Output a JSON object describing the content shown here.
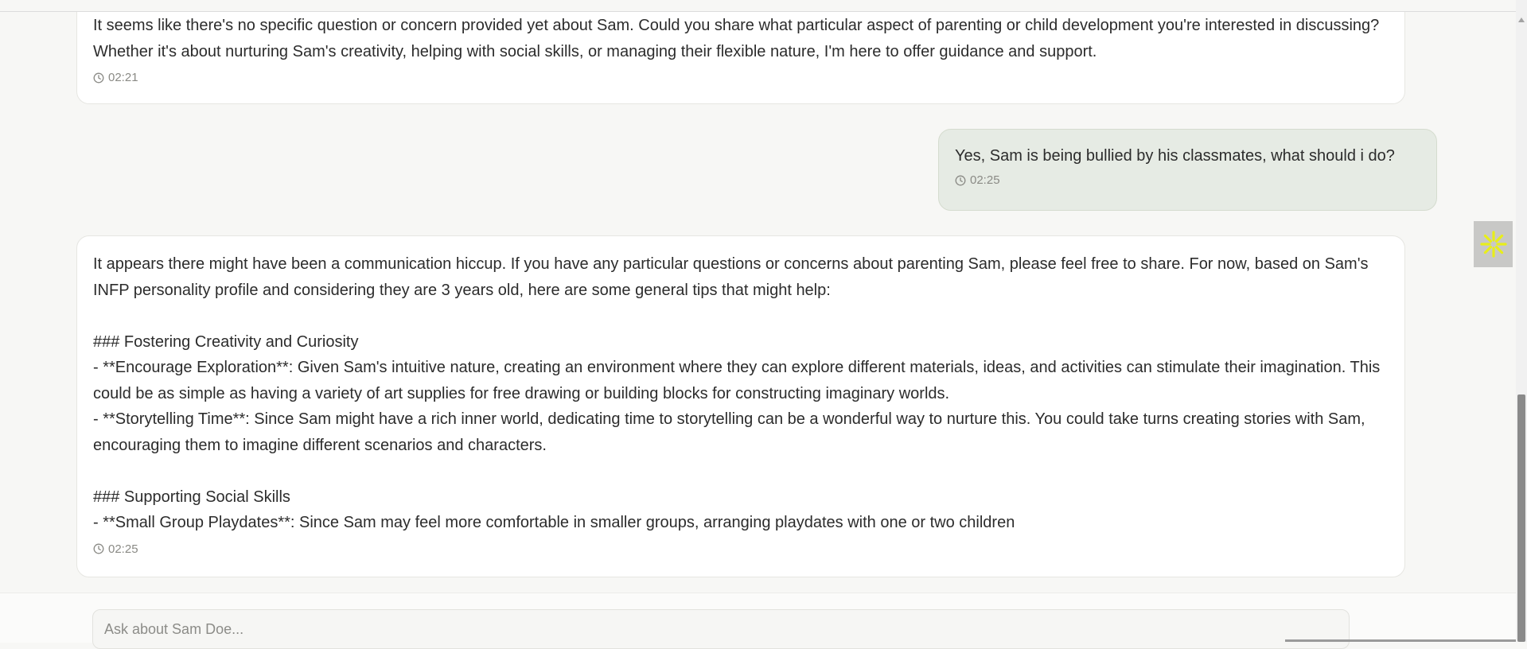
{
  "messages": [
    {
      "role": "assistant",
      "text": "It seems like there's no specific question or concern provided yet about Sam. Could you share what particular aspect of parenting or child development you're interested in discussing? Whether it's about nurturing Sam's creativity, helping with social skills, or managing their flexible nature, I'm here to offer guidance and support.",
      "time": "02:21"
    },
    {
      "role": "user",
      "text": "Yes, Sam is being bullied by his classmates, what should i do?",
      "time": "02:25"
    },
    {
      "role": "assistant",
      "text": "It appears there might have been a communication hiccup. If you have any particular questions or concerns about parenting Sam, please feel free to share. For now, based on Sam's INFP personality profile and considering they are 3 years old, here are some general tips that might help:\n\n### Fostering Creativity and Curiosity\n- **Encourage Exploration**: Given Sam's intuitive nature, creating an environment where they can explore different materials, ideas, and activities can stimulate their imagination. This could be as simple as having a variety of art supplies for free drawing or building blocks for constructing imaginary worlds.\n- **Storytelling Time**: Since Sam might have a rich inner world, dedicating time to storytelling can be a wonderful way to nurture this. You could take turns creating stories with Sam, encouraging them to imagine different scenarios and characters.\n\n### Supporting Social Skills\n- **Small Group Playdates**: Since Sam may feel more comfortable in smaller groups, arranging playdates with one or two children",
      "time": "02:25"
    }
  ],
  "composer": {
    "placeholder": "Ask about Sam Doe..."
  },
  "side_widget": {
    "icon": "asterisk-icon",
    "color": "#e8ee1a"
  },
  "colors": {
    "page_bg": "#f7f7f5",
    "assistant_bubble": "#ffffff",
    "user_bubble": "#e6ebe4",
    "timestamp": "#8a8a85"
  }
}
